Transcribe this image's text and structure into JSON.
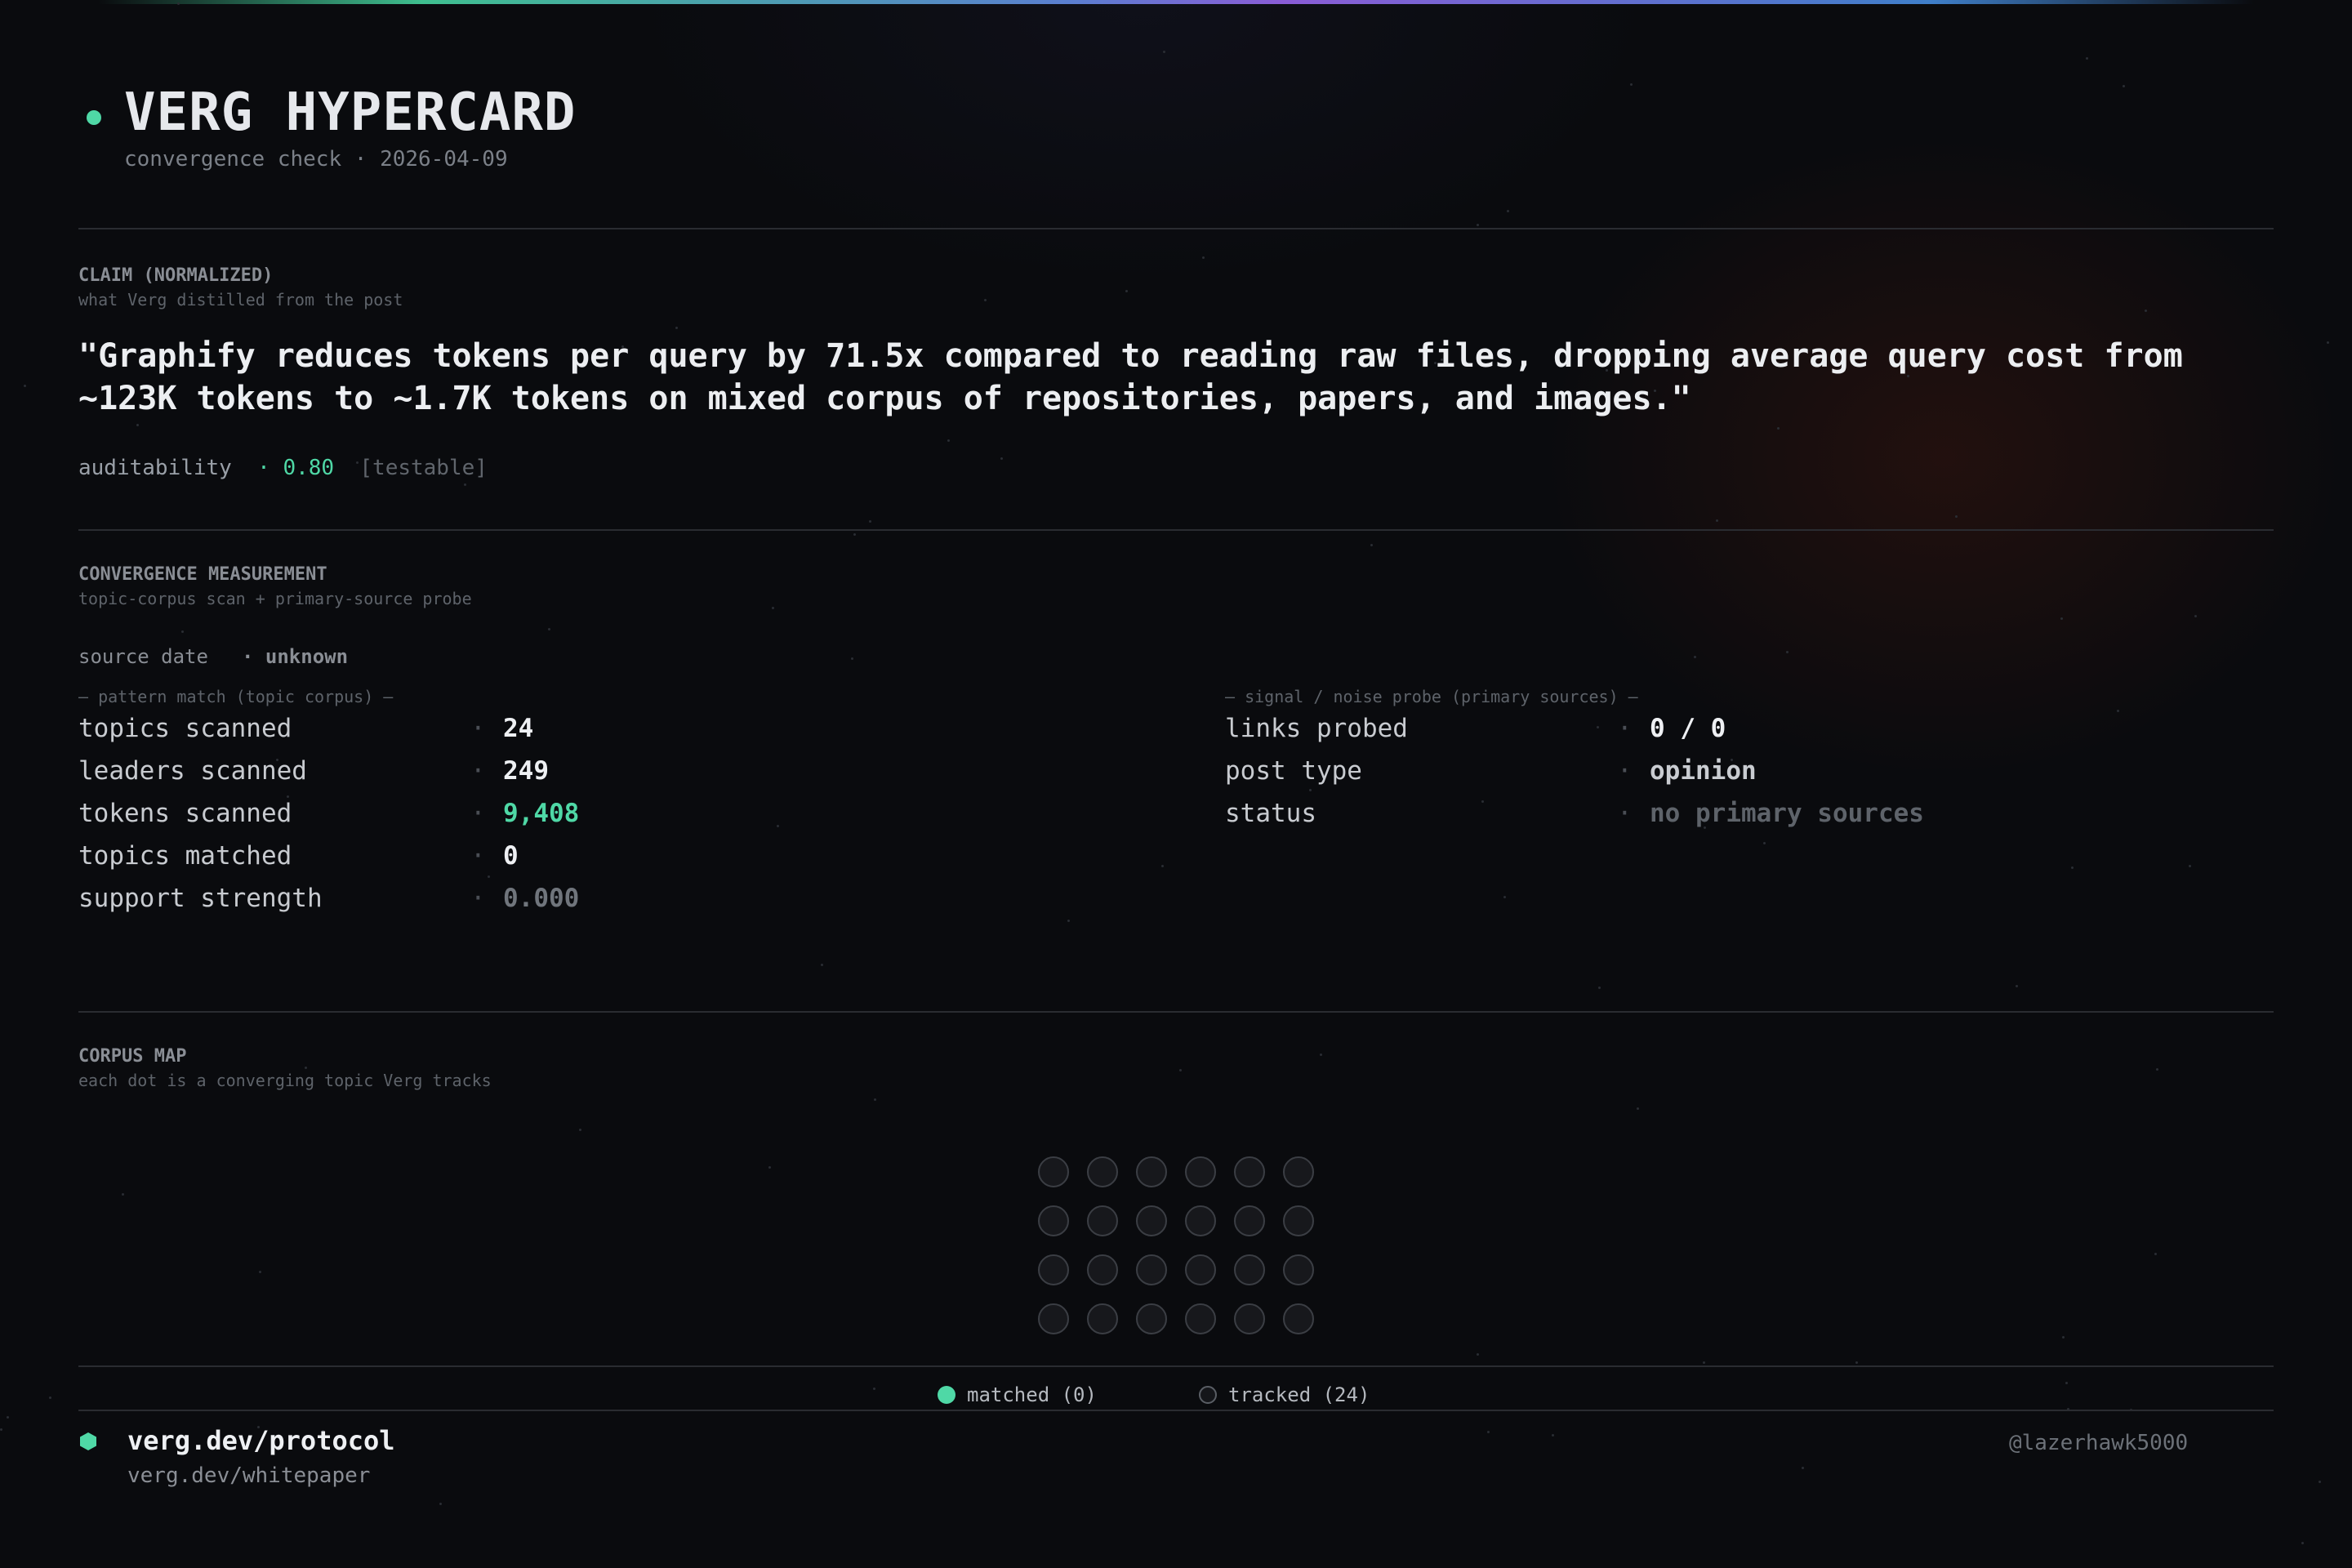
{
  "header": {
    "title": "VERG HYPERCARD",
    "subtitle": "convergence check · 2026-04-09"
  },
  "claim": {
    "label": "CLAIM (NORMALIZED)",
    "sublabel": "what Verg distilled from the post",
    "text": "\"Graphify reduces tokens per query by 71.5x compared to reading raw files, dropping average query cost from ~123K tokens to ~1.7K tokens on mixed corpus of repositories, papers, and images.\"",
    "auditability_label": "auditability",
    "auditability_value": "· 0.80",
    "auditability_tag": "[testable]"
  },
  "convergence": {
    "label": "CONVERGENCE MEASUREMENT",
    "sublabel": "topic-corpus scan + primary-source probe",
    "source_date_label": "source date",
    "source_date_value": "· unknown",
    "pattern_group_label": "— pattern match (topic corpus) —",
    "signal_group_label": "— signal / noise probe (primary sources) —",
    "pattern_rows": [
      {
        "key": "topics scanned",
        "value": "24"
      },
      {
        "key": "leaders scanned",
        "value": "249"
      },
      {
        "key": "tokens scanned",
        "value": "9,408"
      },
      {
        "key": "topics matched",
        "value": "0"
      },
      {
        "key": "support strength",
        "value": "0.000"
      }
    ],
    "signal_rows": [
      {
        "key": "links probed",
        "value": "0 / 0"
      },
      {
        "key": "post type",
        "value": "opinion"
      },
      {
        "key": "status",
        "value": "no primary sources"
      }
    ],
    "separator": "·"
  },
  "corpus_map": {
    "label": "CORPUS MAP",
    "sublabel": "each dot is a converging topic Verg tracks",
    "total_dots": 24,
    "matched_dots": 0,
    "legend_matched": "matched (0)",
    "legend_tracked": "tracked (24)"
  },
  "footer": {
    "primary_link": "verg.dev/protocol",
    "secondary_link": "verg.dev/whitepaper",
    "handle": "@lazerhawk5000"
  },
  "colors": {
    "accent": "#4fd8a6",
    "background": "#0a0b0e",
    "text": "#eef0f3",
    "muted": "#70757c"
  },
  "icons": {
    "title_status": "status-dot-icon",
    "footer_mark": "hexagon-icon"
  }
}
